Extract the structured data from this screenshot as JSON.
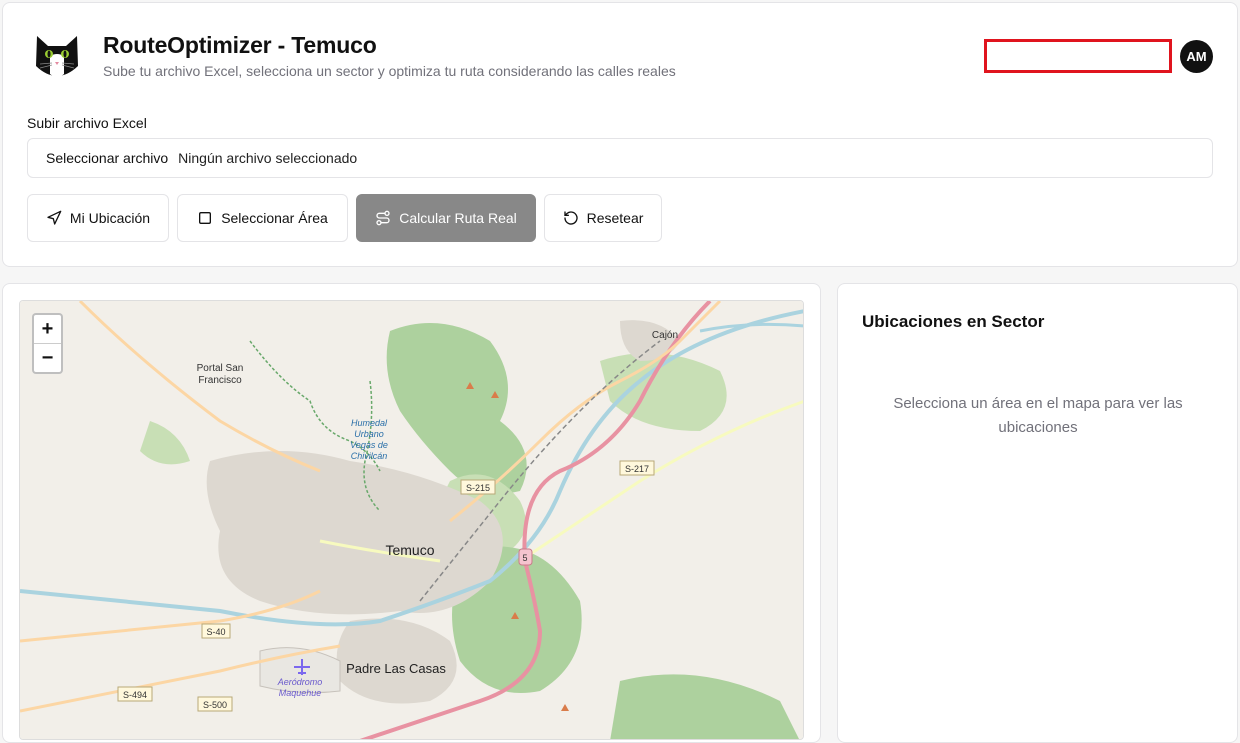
{
  "header": {
    "title": "RouteOptimizer - Temuco",
    "subtitle": "Sube tu archivo Excel, selecciona un sector y optimiza tu ruta considerando las calles reales",
    "avatar_initials": "AM"
  },
  "upload": {
    "label": "Subir archivo Excel",
    "button_label": "Seleccionar archivo",
    "status": "Ningún archivo seleccionado"
  },
  "actions": {
    "my_location": "Mi Ubicación",
    "select_area": "Seleccionar Área",
    "calculate_route": "Calcular Ruta Real",
    "reset": "Resetear"
  },
  "map": {
    "zoom_in": "+",
    "zoom_out": "−",
    "labels": {
      "portal_1": "Portal San",
      "portal_2": "Francisco",
      "humedal_1": "Humedal",
      "humedal_2": "Urbano",
      "humedal_3": "Vegas de",
      "humedal_4": "Chivilcán",
      "cajon": "Cajón",
      "temuco": "Temuco",
      "padre_las_casas": "Padre Las Casas",
      "aerodromo_1": "Aeródromo",
      "aerodromo_2": "Maquehue",
      "s215": "S-215",
      "s217": "S-217",
      "s40": "S-40",
      "s494": "S-494",
      "s500": "S-500",
      "r5": "5"
    }
  },
  "sidebar": {
    "title": "Ubicaciones en Sector",
    "empty_message": "Selecciona un área en el mapa para ver las ubicaciones"
  },
  "colors": {
    "accent_disabled": "#888888",
    "highlight_box": "#e0141e",
    "map_land": "#f2efe9",
    "map_forest": "#add19e",
    "map_water": "#aad3df",
    "map_motorway": "#e892a2",
    "map_primary": "#fcd6a4"
  }
}
